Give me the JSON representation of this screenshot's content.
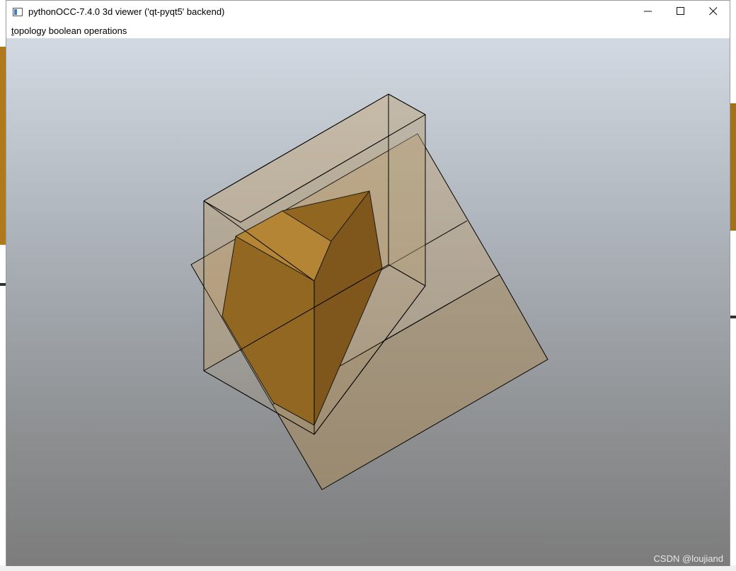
{
  "window": {
    "title": "pythonOCC-7.4.0 3d viewer ('qt-pyqt5' backend)",
    "icon": "qt-window-icon",
    "controls": {
      "minimize": "—",
      "maximize": "☐",
      "close": "✕"
    }
  },
  "menu": {
    "items": [
      {
        "accelerator": "t",
        "rest": "opology boolean operations"
      }
    ]
  },
  "viewer": {
    "background_top": "#d3d9e2",
    "background_bottom": "#7c7c7c",
    "solid_color": "#b07a1c",
    "transparent_color": "#bfa070",
    "edge_color": "#000000"
  },
  "watermark": "CSDN @loujiand"
}
